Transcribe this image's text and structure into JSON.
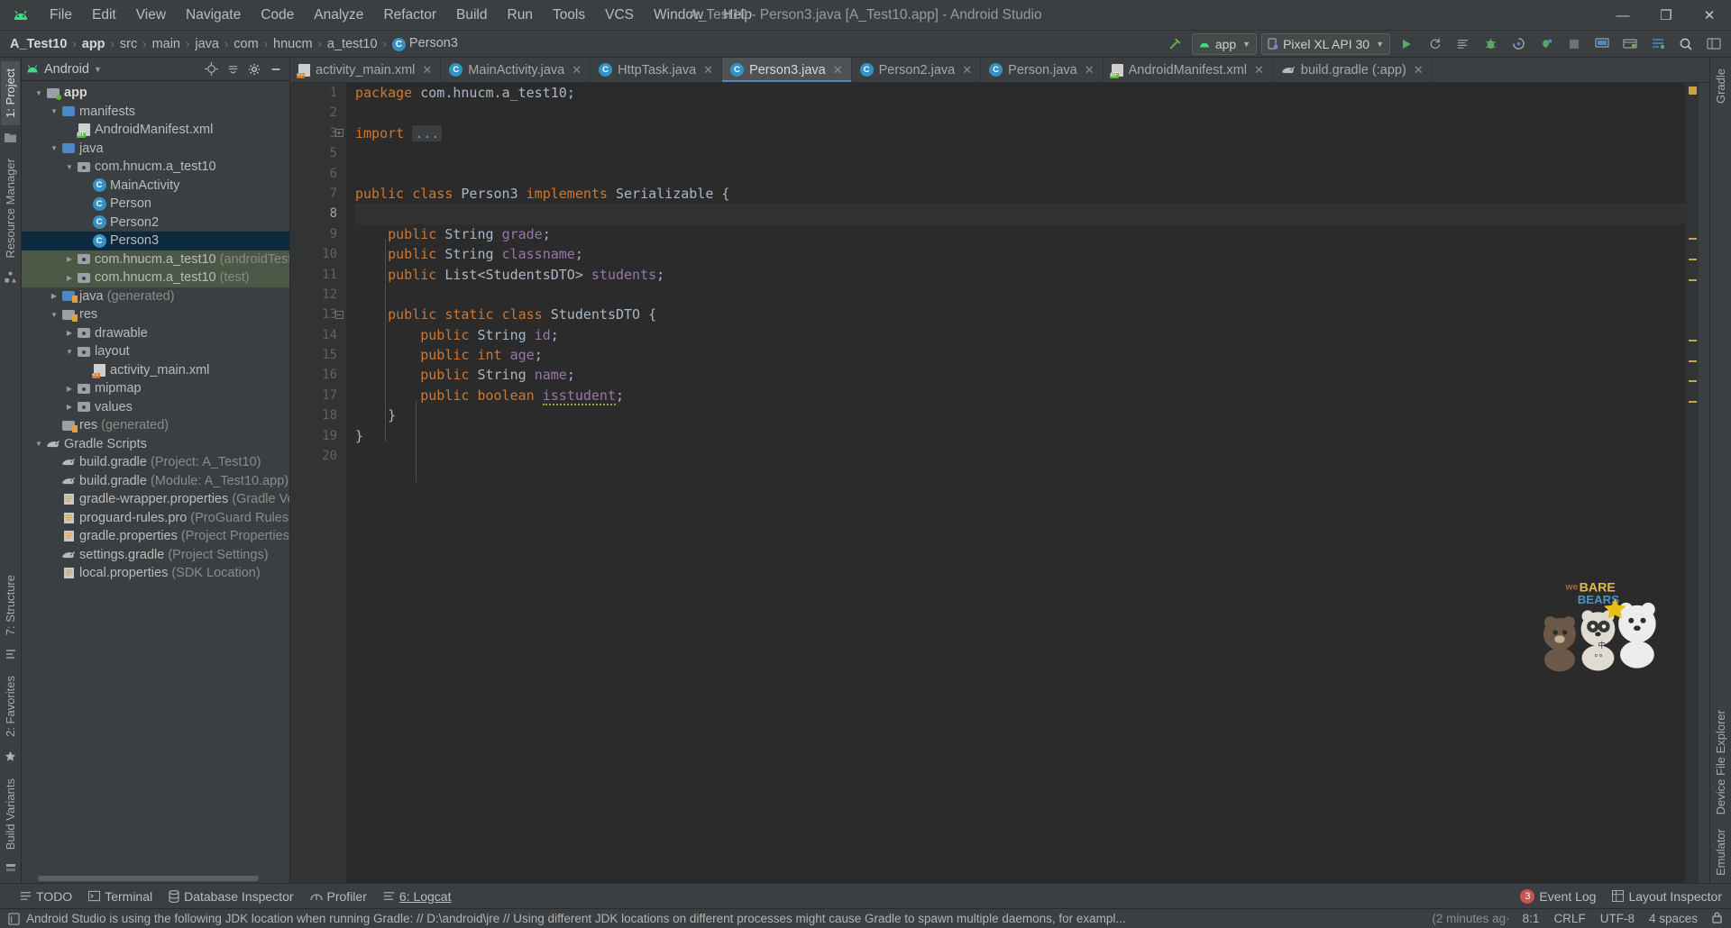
{
  "window": {
    "title": "A_Test10 - Person3.java [A_Test10.app] - Android Studio",
    "minimize": "—",
    "maximize": "❐",
    "close": "✕"
  },
  "menu": [
    {
      "label": "File"
    },
    {
      "label": "Edit"
    },
    {
      "label": "View"
    },
    {
      "label": "Navigate"
    },
    {
      "label": "Code"
    },
    {
      "label": "Analyze"
    },
    {
      "label": "Refactor"
    },
    {
      "label": "Build"
    },
    {
      "label": "Run"
    },
    {
      "label": "Tools"
    },
    {
      "label": "VCS"
    },
    {
      "label": "Window"
    },
    {
      "label": "Help"
    }
  ],
  "breadcrumb": {
    "items": [
      "A_Test10",
      "app",
      "src",
      "main",
      "java",
      "com",
      "hnucm",
      "a_test10"
    ],
    "last": "Person3",
    "separator": "›"
  },
  "toolbar": {
    "build_hammer": "hammer-icon",
    "run_config": "app",
    "device": "Pixel XL API 30",
    "run": "▶",
    "rerun": "⟳",
    "apply_changes": "≡",
    "debug": "debug-icon",
    "profile": "profile-icon",
    "attach_debugger": "attach-icon",
    "stop": "■",
    "avd": "avd-icon",
    "sdk": "sdk-icon",
    "sync": "sync-icon",
    "search": "⌕",
    "project_structure": "structure-icon"
  },
  "left_strip": {
    "project_tab": "1: Project",
    "resource_manager_tab": "Resource Manager",
    "structure_tab": "7: Structure",
    "favorites_tab": "2: Favorites",
    "build_variants_tab": "Build Variants"
  },
  "right_strip": {
    "gradle_tab": "Gradle",
    "device_file_explorer_tab": "Device File Explorer",
    "emulator_tab": "Emulator"
  },
  "project_panel": {
    "view_selector": "Android",
    "caret": "▾",
    "actions": [
      "target-icon",
      "collapse-all-icon",
      "settings-icon",
      "hide-icon"
    ],
    "tree": [
      {
        "depth": 0,
        "arrow": "▼",
        "icon": "folder-src",
        "label": "app",
        "bold": true,
        "dim": "",
        "state": "normal"
      },
      {
        "depth": 1,
        "arrow": "▼",
        "icon": "folder-blue",
        "label": "manifests",
        "bold": false,
        "dim": "",
        "state": "normal"
      },
      {
        "depth": 2,
        "arrow": "",
        "icon": "manifest-xml",
        "label": "AndroidManifest.xml",
        "bold": false,
        "dim": "",
        "state": "normal"
      },
      {
        "depth": 1,
        "arrow": "▼",
        "icon": "folder-blue",
        "label": "java",
        "bold": false,
        "dim": "",
        "state": "normal"
      },
      {
        "depth": 2,
        "arrow": "▼",
        "icon": "folder-pkg",
        "label": "com.hnucm.a_test10",
        "bold": false,
        "dim": "",
        "state": "normal"
      },
      {
        "depth": 3,
        "arrow": "",
        "icon": "class",
        "label": "MainActivity",
        "bold": false,
        "dim": "",
        "state": "normal"
      },
      {
        "depth": 3,
        "arrow": "",
        "icon": "class",
        "label": "Person",
        "bold": false,
        "dim": "",
        "state": "normal"
      },
      {
        "depth": 3,
        "arrow": "",
        "icon": "class",
        "label": "Person2",
        "bold": false,
        "dim": "",
        "state": "normal"
      },
      {
        "depth": 3,
        "arrow": "",
        "icon": "class",
        "label": "Person3",
        "bold": false,
        "dim": "",
        "state": "selected"
      },
      {
        "depth": 2,
        "arrow": "▶",
        "icon": "folder-pkg",
        "label": "com.hnucm.a_test10",
        "bold": false,
        "dim": "(androidTest)",
        "state": "testsrc"
      },
      {
        "depth": 2,
        "arrow": "▶",
        "icon": "folder-pkg",
        "label": "com.hnucm.a_test10",
        "bold": false,
        "dim": "(test)",
        "state": "testsrc"
      },
      {
        "depth": 1,
        "arrow": "▶",
        "icon": "folder-gen",
        "label": "java",
        "bold": false,
        "dim": "(generated)",
        "state": "normal"
      },
      {
        "depth": 1,
        "arrow": "▼",
        "icon": "folder-res",
        "label": "res",
        "bold": false,
        "dim": "",
        "state": "normal"
      },
      {
        "depth": 2,
        "arrow": "▶",
        "icon": "folder-pkg",
        "label": "drawable",
        "bold": false,
        "dim": "",
        "state": "normal"
      },
      {
        "depth": 2,
        "arrow": "▼",
        "icon": "folder-pkg",
        "label": "layout",
        "bold": false,
        "dim": "",
        "state": "normal"
      },
      {
        "depth": 3,
        "arrow": "",
        "icon": "layout-xml",
        "label": "activity_main.xml",
        "bold": false,
        "dim": "",
        "state": "normal"
      },
      {
        "depth": 2,
        "arrow": "▶",
        "icon": "folder-pkg",
        "label": "mipmap",
        "bold": false,
        "dim": "",
        "state": "normal"
      },
      {
        "depth": 2,
        "arrow": "▶",
        "icon": "folder-pkg",
        "label": "values",
        "bold": false,
        "dim": "",
        "state": "normal"
      },
      {
        "depth": 1,
        "arrow": "",
        "icon": "folder-res",
        "label": "res",
        "bold": false,
        "dim": "(generated)",
        "state": "normal"
      },
      {
        "depth": 0,
        "arrow": "▼",
        "icon": "gradle",
        "label": "Gradle Scripts",
        "bold": false,
        "dim": "",
        "state": "normal"
      },
      {
        "depth": 1,
        "arrow": "",
        "icon": "gradle",
        "label": "build.gradle",
        "bold": false,
        "dim": "(Project: A_Test10)",
        "state": "normal"
      },
      {
        "depth": 1,
        "arrow": "",
        "icon": "gradle",
        "label": "build.gradle",
        "bold": false,
        "dim": "(Module: A_Test10.app)",
        "state": "normal"
      },
      {
        "depth": 1,
        "arrow": "",
        "icon": "props",
        "label": "gradle-wrapper.properties",
        "bold": false,
        "dim": "(Gradle Version)",
        "state": "normal"
      },
      {
        "depth": 1,
        "arrow": "",
        "icon": "props",
        "label": "proguard-rules.pro",
        "bold": false,
        "dim": "(ProGuard Rules for A",
        "state": "normal"
      },
      {
        "depth": 1,
        "arrow": "",
        "icon": "props",
        "label": "gradle.properties",
        "bold": false,
        "dim": "(Project Properties)",
        "state": "normal"
      },
      {
        "depth": 1,
        "arrow": "",
        "icon": "gradle",
        "label": "settings.gradle",
        "bold": false,
        "dim": "(Project Settings)",
        "state": "normal"
      },
      {
        "depth": 1,
        "arrow": "",
        "icon": "props",
        "label": "local.properties",
        "bold": false,
        "dim": "(SDK Location)",
        "state": "normal"
      }
    ]
  },
  "editor_tabs": [
    {
      "label": "activity_main.xml",
      "icon": "layout-xml",
      "active": false
    },
    {
      "label": "MainActivity.java",
      "icon": "class",
      "active": false
    },
    {
      "label": "HttpTask.java",
      "icon": "class",
      "active": false
    },
    {
      "label": "Person3.java",
      "icon": "class",
      "active": true
    },
    {
      "label": "Person2.java",
      "icon": "class",
      "active": false
    },
    {
      "label": "Person.java",
      "icon": "class",
      "active": false
    },
    {
      "label": "AndroidManifest.xml",
      "icon": "manifest-xml",
      "active": false
    },
    {
      "label": "build.gradle (:app)",
      "icon": "gradle",
      "active": false
    }
  ],
  "code": {
    "language": "java",
    "current_line": 8,
    "lines": [
      {
        "n": 1,
        "text": "package com.hnucm.a_test10;"
      },
      {
        "n": 2,
        "text": ""
      },
      {
        "n": 3,
        "text": "import ..."
      },
      {
        "n": 5,
        "text": ""
      },
      {
        "n": 6,
        "text": ""
      },
      {
        "n": 7,
        "text": "public class Person3 implements Serializable {"
      },
      {
        "n": 8,
        "text": ""
      },
      {
        "n": 9,
        "text": "    public String grade;"
      },
      {
        "n": 10,
        "text": "    public String classname;"
      },
      {
        "n": 11,
        "text": "    public List<StudentsDTO> students;"
      },
      {
        "n": 12,
        "text": ""
      },
      {
        "n": 13,
        "text": "    public static class StudentsDTO {"
      },
      {
        "n": 14,
        "text": "        public String id;"
      },
      {
        "n": 15,
        "text": "        public int age;"
      },
      {
        "n": 16,
        "text": "        public String name;"
      },
      {
        "n": 17,
        "text": "        public boolean isstudent;"
      },
      {
        "n": 18,
        "text": "    }"
      },
      {
        "n": 19,
        "text": "}"
      },
      {
        "n": 20,
        "text": ""
      }
    ],
    "fold_placeholder": "..."
  },
  "bottom_bar": {
    "items": [
      {
        "label": "TODO",
        "icon": "todo-icon"
      },
      {
        "label": "Terminal",
        "icon": "terminal-icon"
      },
      {
        "label": "Database Inspector",
        "icon": "database-icon"
      },
      {
        "label": "Profiler",
        "icon": "profiler-icon"
      },
      {
        "label": "6: Logcat",
        "icon": "logcat-icon"
      }
    ],
    "event_log": "Event Log",
    "event_count": "3",
    "layout_inspector": "Layout Inspector"
  },
  "status_bar": {
    "message": "Android Studio is using the following JDK location when running Gradle: // D:\\android\\jre // Using different JDK locations on different processes might cause Gradle to spawn multiple daemons, for exampl...",
    "time_ago": "(2 minutes ag·",
    "caret": "8:1",
    "line_sep": "CRLF",
    "encoding": "UTF-8",
    "indent": "4 spaces"
  },
  "colors": {
    "accent_blue": "#3592c4",
    "selection": "#0d293e",
    "test_source": "#4b5845",
    "keyword": "#cc7832",
    "field": "#9876aa",
    "editor_bg": "#2b2b2b",
    "panel_bg": "#3c3f41",
    "error_red": "#c75450",
    "green": "#62b543"
  }
}
